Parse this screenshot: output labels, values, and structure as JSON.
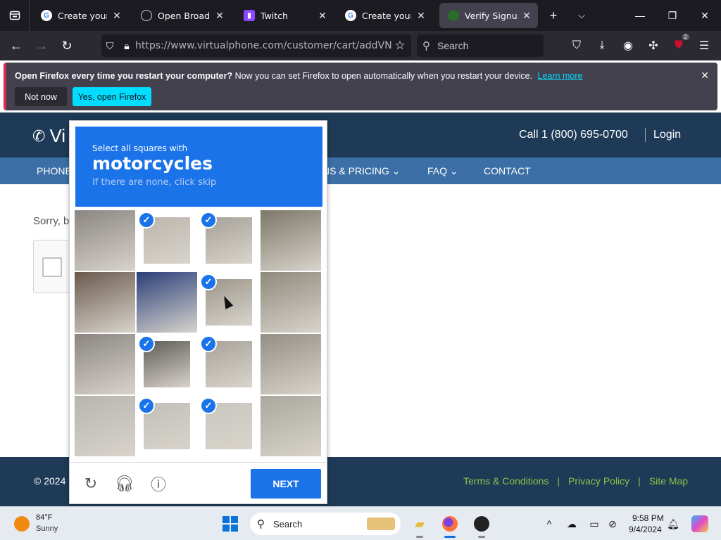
{
  "browser": {
    "tabs": [
      {
        "title": "Create your Goo",
        "favicon": "google-icon"
      },
      {
        "title": "Open Broadcast",
        "favicon": "obs-icon"
      },
      {
        "title": "Twitch",
        "favicon": "twitch-icon"
      },
      {
        "title": "Create your Goo",
        "favicon": "google-icon"
      },
      {
        "title": "Verify Signup",
        "favicon": "verify-icon",
        "active": true
      }
    ],
    "url": "https://www.virtualphone.com/customer/cart/addVNA?",
    "search_placeholder": "Search",
    "extension_badge": "2"
  },
  "notification": {
    "bold": "Open Firefox every time you restart your computer?",
    "text": "Now you can set Firefox to open automatically when you restart your device.",
    "link": "Learn more",
    "not_now": "Not now",
    "yes": "Yes, open Firefox"
  },
  "site": {
    "logo_text": "Vi",
    "call": "Call 1 (800) 695-0700",
    "login": "Login",
    "nav": [
      "PHONE",
      "NS & PRICING ⌄",
      "FAQ ⌄",
      "CONTACT"
    ],
    "sorry_text": "Sorry, b",
    "copyright": "© 2024",
    "footer_links": [
      "Terms & Conditions",
      "Privacy Policy",
      "Site Map"
    ],
    "colors": {
      "header": "#1e3a57",
      "nav": "#3b6fa5",
      "footer_link": "#8bc34a"
    }
  },
  "captcha": {
    "instruction": "Select all squares with",
    "target": "motorcycles",
    "hint": "If there are none, click skip",
    "selected": [
      [
        false,
        true,
        true,
        false
      ],
      [
        false,
        false,
        true,
        false
      ],
      [
        false,
        true,
        true,
        false
      ],
      [
        false,
        true,
        true,
        false
      ]
    ],
    "next_label": "NEXT",
    "accent": "#1a73e8"
  },
  "taskbar": {
    "temp": "84°F",
    "condition": "Sunny",
    "search": "Search",
    "time": "9:58 PM",
    "date": "9/4/2024"
  }
}
